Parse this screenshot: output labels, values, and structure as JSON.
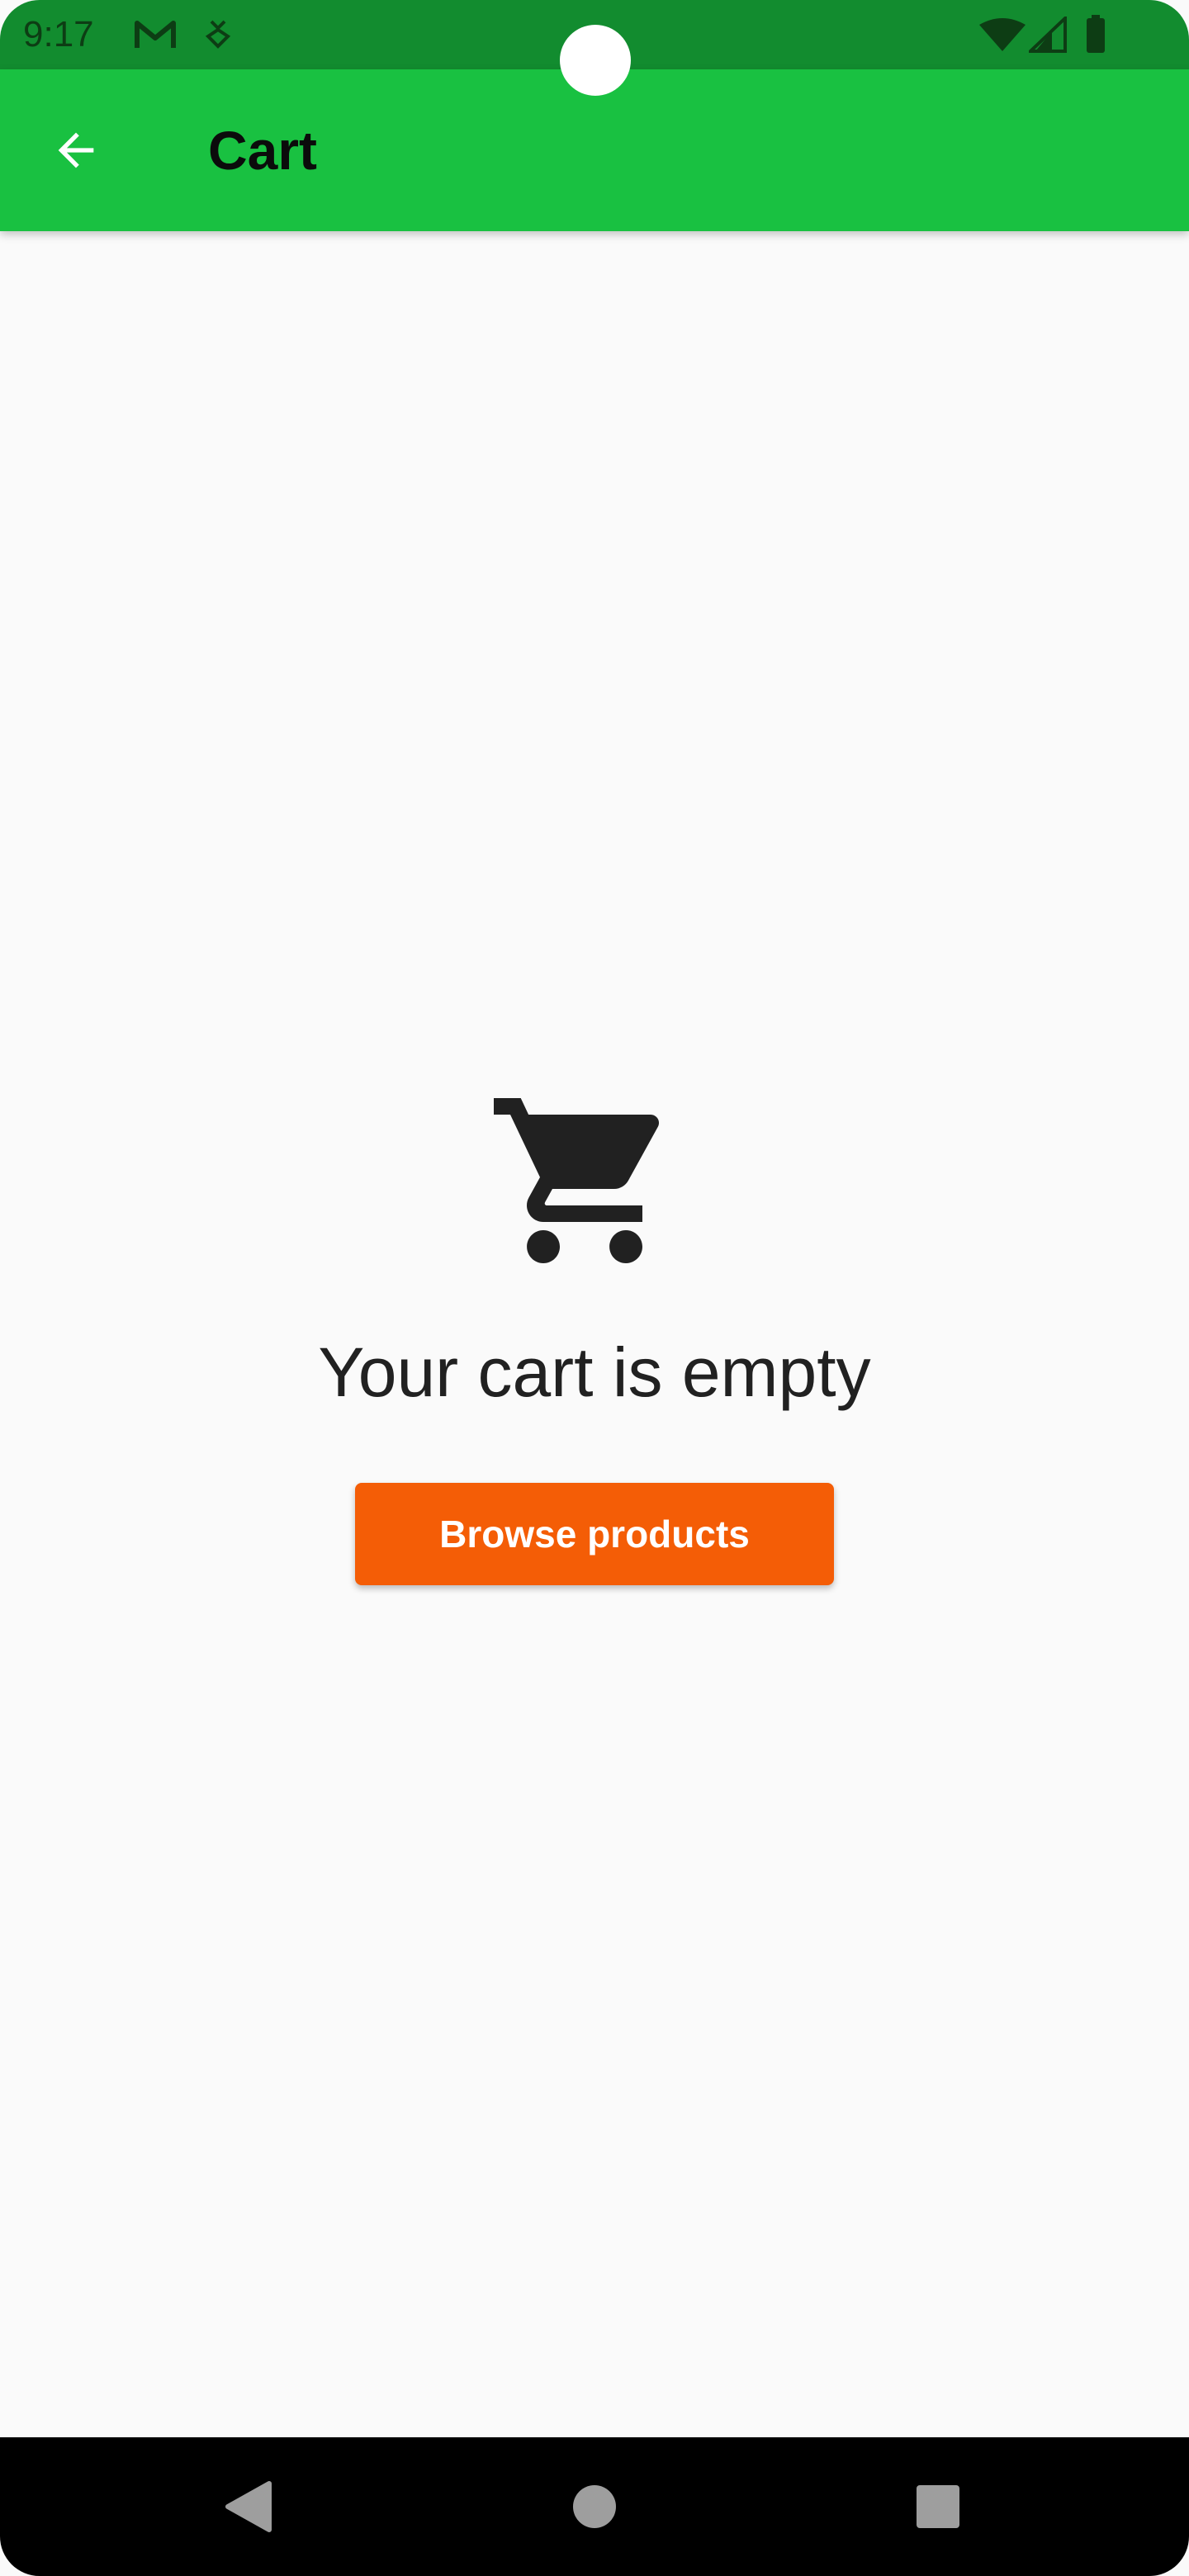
{
  "status_bar": {
    "time": "9:17",
    "icons": [
      "gmail-icon",
      "download-notification-icon",
      "wifi-icon",
      "signal-icon",
      "battery-icon"
    ],
    "background_color": "#128c2f"
  },
  "app_bar": {
    "title": "Cart",
    "back_icon": "arrow-back-icon",
    "background_color": "#19c141"
  },
  "empty_state": {
    "icon": "shopping-cart-icon",
    "message": "Your cart is empty",
    "button_label": "Browse products",
    "button_color": "#f45d06"
  },
  "nav_bar": {
    "buttons": [
      "back-triangle-icon",
      "home-circle-icon",
      "recents-square-icon"
    ]
  }
}
